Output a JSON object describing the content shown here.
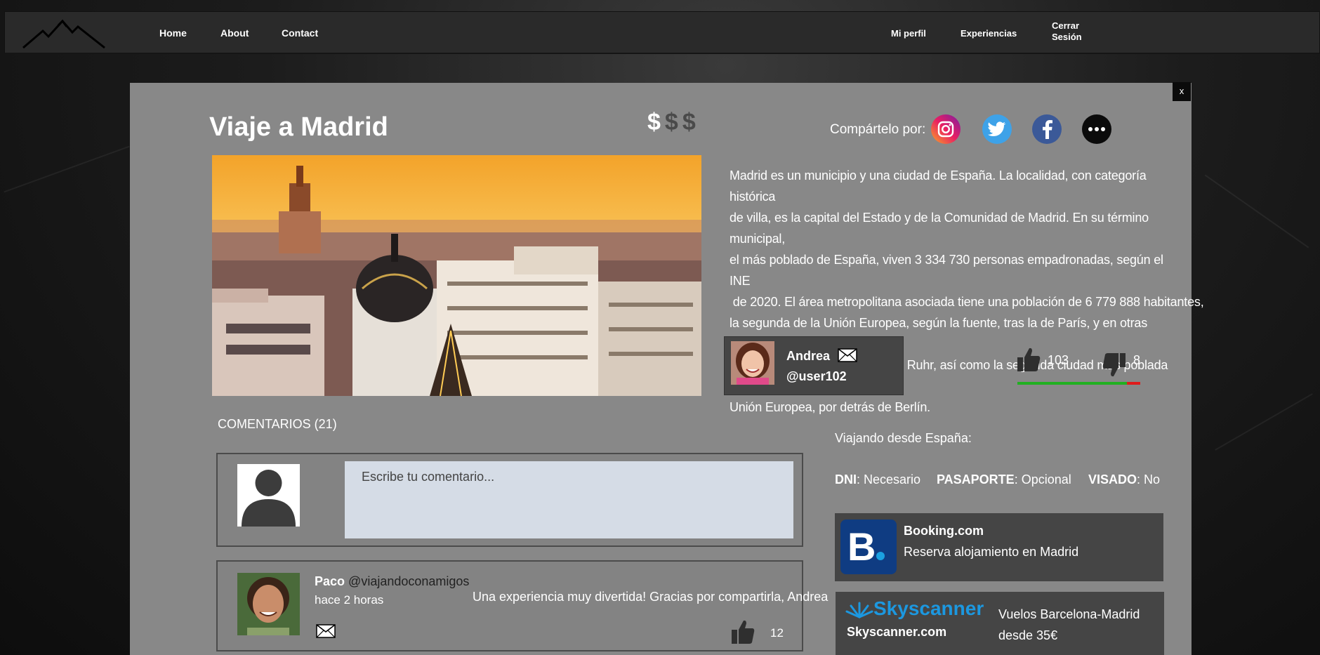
{
  "nav": {
    "home": "Home",
    "about": "About",
    "contact": "Contact",
    "profile": "Mi perfil",
    "experiences": "Experiencias",
    "logout_line1": "Cerrar",
    "logout_line2": "Sesión"
  },
  "modal": {
    "close": "x",
    "title": "Viaje a Madrid",
    "price_symbols": [
      "$",
      "$",
      "$"
    ],
    "price_level": 1,
    "share_label": "Compártelo por:",
    "social": [
      "instagram-icon",
      "twitter-icon",
      "facebook-icon",
      "more-icon"
    ],
    "description": [
      "Madrid es un municipio y una ciudad de España. La localidad, con categoría histórica",
      "de villa, es la capital del Estado y de la Comunidad de Madrid. En su término municipal,",
      "el más poblado de España, viven 3 334 730 personas empadronadas, según el INE",
      " de 2020. El área metropolitana asociada tiene una población de 6 779 888 habitantes,",
      "la segunda de la Unión Europea, según la fuente, tras la de París, y en otras fuentes",
      "detrás también de la Región del Ruhr, así como la segunda ciudad más poblada de la",
      "Unión Europea, por detrás de Berlín."
    ]
  },
  "author": {
    "name": "Andrea",
    "handle": "@user102"
  },
  "votes": {
    "likes": "103",
    "dislikes": "8",
    "like_color": "#20b020",
    "dislike_color": "#e01b1b"
  },
  "comments": {
    "title": "COMENTARIOS (21)",
    "placeholder": "Escribe tu comentario...",
    "items": [
      {
        "name": "Paco",
        "handle": "@viajandoconamigos",
        "time": "hace 2 horas",
        "text": "Una experiencia muy divertida! Gracias por compartirla, Andrea",
        "likes": "12"
      }
    ]
  },
  "travel": {
    "from": "Viajando desde España:",
    "docs": [
      {
        "label": "DNI",
        "value": ": Necesario"
      },
      {
        "label": "PASAPORTE",
        "value": ": Opcional"
      },
      {
        "label": "VISADO",
        "value": ": No"
      }
    ]
  },
  "ads": {
    "booking": {
      "logo": "B.",
      "title": "Booking.com",
      "sub": "Reserva alojamiento en Madrid"
    },
    "skyscanner": {
      "logo": "Skyscanner",
      "title": "Skyscanner.com",
      "sub_line1": "Vuelos Barcelona-Madrid",
      "sub_line2": "desde 35€"
    }
  }
}
